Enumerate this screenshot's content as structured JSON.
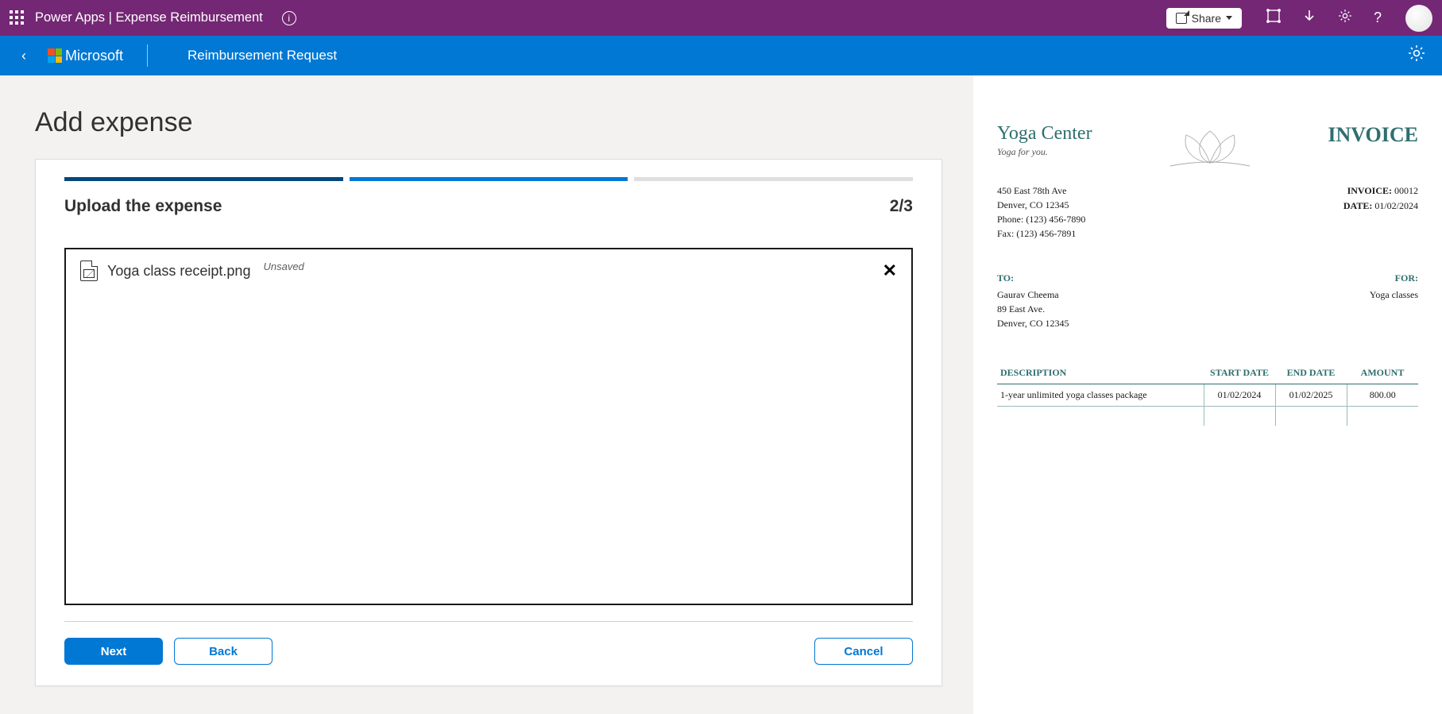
{
  "topbar": {
    "breadcrumb": "Power Apps  |  Expense Reimbursement",
    "share_label": "Share"
  },
  "subbar": {
    "brand": "Microsoft",
    "page": "Reimbursement Request"
  },
  "page": {
    "title": "Add expense"
  },
  "wizard": {
    "step_title": "Upload the expense",
    "step_count": "2/3",
    "file_name": "Yoga class receipt.png",
    "file_status": "Unsaved",
    "buttons": {
      "next": "Next",
      "back": "Back",
      "cancel": "Cancel"
    }
  },
  "invoice": {
    "vendor_name": "Yoga Center",
    "vendor_tag": "Yoga for you.",
    "heading": "INVOICE",
    "address": {
      "line1": "450 East 78th Ave",
      "line2": "Denver, CO 12345",
      "phone": "Phone: (123) 456-7890",
      "fax": "Fax: (123) 456-7891"
    },
    "meta": {
      "invoice_no_label": "INVOICE:",
      "invoice_no": "00012",
      "date_label": "DATE:",
      "date": "01/02/2024"
    },
    "to_label": "TO:",
    "for_label": "FOR:",
    "to": {
      "name": "Gaurav Cheema",
      "line1": "89 East Ave.",
      "line2": "Denver, CO 12345"
    },
    "for_value": "Yoga classes",
    "columns": {
      "desc": "DESCRIPTION",
      "start": "START DATE",
      "end": "END DATE",
      "amount": "AMOUNT"
    },
    "rows": [
      {
        "desc": "1-year unlimited yoga classes package",
        "start": "01/02/2024",
        "end": "01/02/2025",
        "amount": "800.00"
      }
    ]
  }
}
